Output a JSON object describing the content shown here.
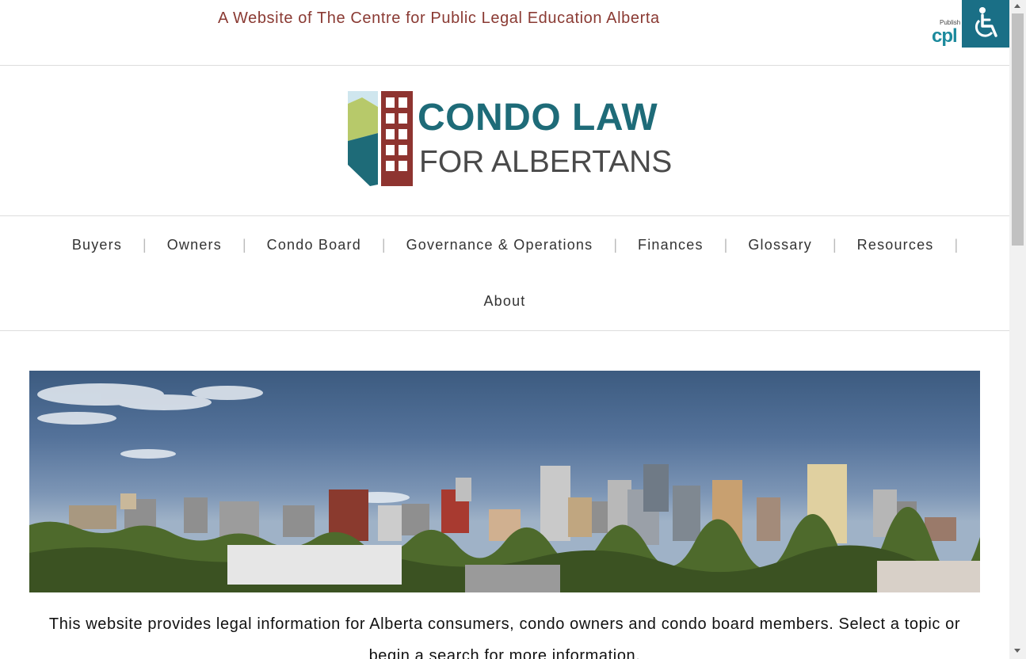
{
  "header": {
    "tagline": "A Website of The Centre for Public Legal Education Alberta",
    "publisher_small": "Publish",
    "publisher_logo": "cpl",
    "accessibility_icon": "wheelchair-icon"
  },
  "logo": {
    "line1": "CONDO LAW",
    "line2": "FOR ALBERTANS",
    "colors": {
      "teal": "#1e6b78",
      "brick": "#8e3430",
      "lime": "#b7c96a",
      "gray": "#4a4a4a"
    }
  },
  "nav": {
    "items": [
      {
        "label": "Buyers"
      },
      {
        "label": "Owners"
      },
      {
        "label": "Condo Board"
      },
      {
        "label": "Governance & Operations"
      },
      {
        "label": "Finances"
      },
      {
        "label": "Glossary"
      },
      {
        "label": "Resources"
      },
      {
        "label": "About"
      }
    ],
    "separator": "|"
  },
  "intro": {
    "text": "This website provides legal information for Alberta consumers, condo owners and condo board members. Select a topic or begin a search for more information."
  },
  "colors": {
    "tagline": "#8a3a33",
    "accent": "#1a6f86"
  }
}
